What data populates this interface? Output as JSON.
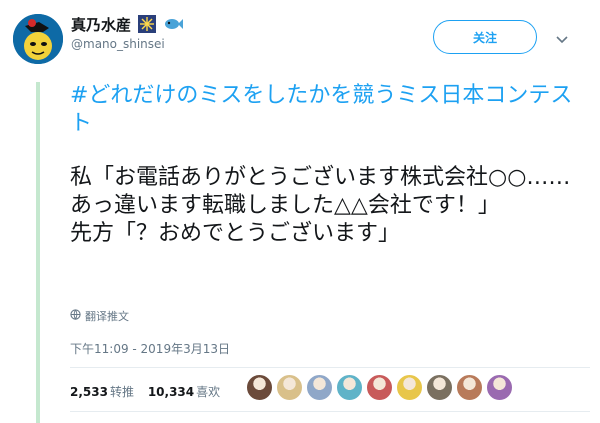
{
  "user": {
    "name": "真乃水産",
    "handle": "@mano_shinsei",
    "follow_label": "关注"
  },
  "tweet": {
    "hashtag_line": "#どれだけのミスをしたかを競うミス日本コンテスト",
    "body_line1": "私「お電話ありがとうございます株式会社○○……あっ違います転職しました△△会社です！」",
    "body_line2": "先方「？おめでとうございます」",
    "translate_label": "翻译推文",
    "timestamp": "下午11:09 - 2019年3月13日"
  },
  "stats": {
    "retweets_count": "2,533",
    "retweets_label": "转推",
    "likes_count": "10,334",
    "likes_label": "喜欢"
  },
  "likers": [
    {
      "icon": "liker-avatar",
      "color": "#6b4a3a"
    },
    {
      "icon": "liker-avatar",
      "color": "#d9c08a"
    },
    {
      "icon": "liker-avatar",
      "color": "#8fa7c8"
    },
    {
      "icon": "liker-avatar",
      "color": "#5fb3c8"
    },
    {
      "icon": "liker-avatar",
      "color": "#c85a5a"
    },
    {
      "icon": "liker-avatar",
      "color": "#e8c64a"
    },
    {
      "icon": "liker-avatar",
      "color": "#7a7060"
    },
    {
      "icon": "liker-avatar",
      "color": "#b87a5a"
    },
    {
      "icon": "liker-avatar",
      "color": "#9a6ab0"
    }
  ],
  "colors": {
    "accent": "#1da1f2",
    "thread_line": "#c5e8cf",
    "muted": "#657786"
  }
}
